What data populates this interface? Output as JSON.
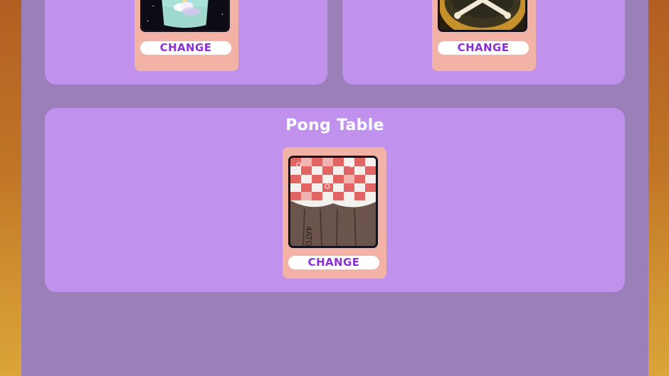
{
  "panels": {
    "left": {
      "button_label": "CHANGE",
      "thumbnail": "rainbow-cup-icon"
    },
    "right": {
      "button_label": "CHANGE",
      "thumbnail": "skull-crossbones-ball-icon"
    },
    "table": {
      "title": "Pong Table",
      "button_label": "CHANGE",
      "thumbnail": "checkered-tablecloth-icon"
    }
  },
  "colors": {
    "background_gradient_top": "#b35e22",
    "background_gradient_bottom": "#dca43a",
    "frame": "#9b7fb8",
    "panel": "#c092ee",
    "card": "#f3b2a6",
    "button_text": "#8c2fd6"
  }
}
